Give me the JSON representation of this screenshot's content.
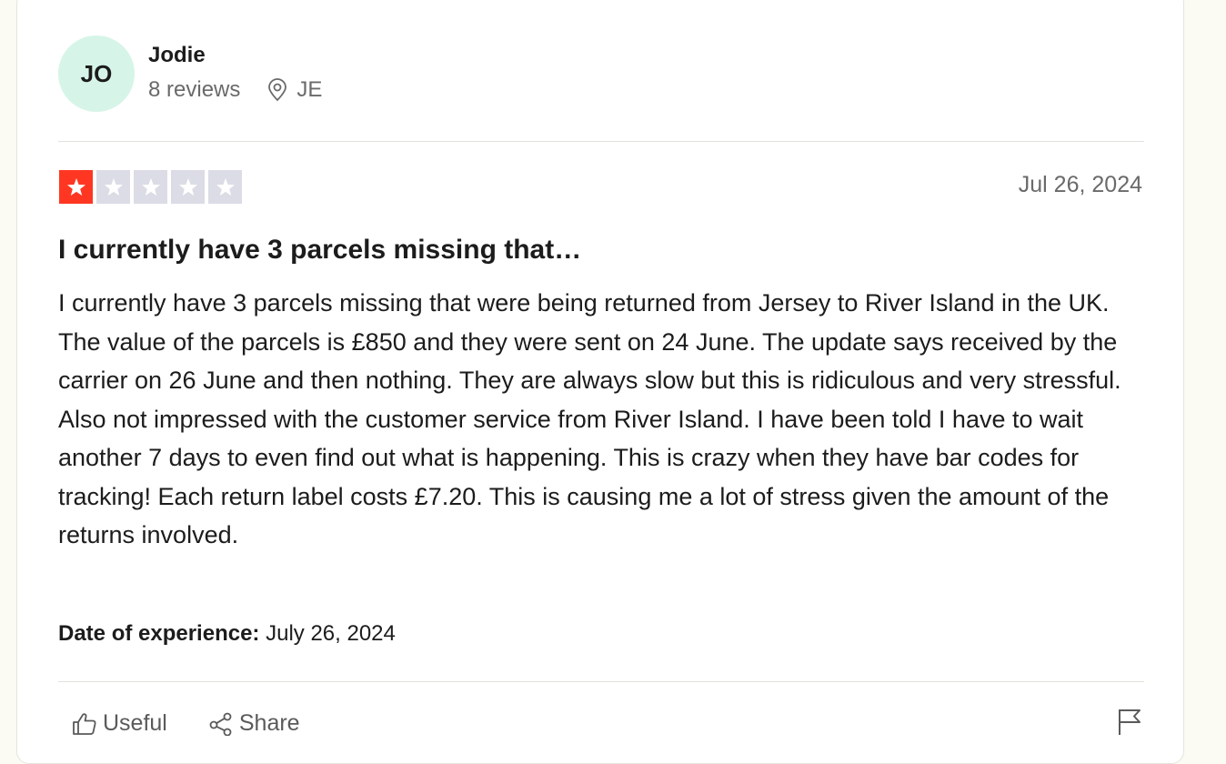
{
  "reviewer": {
    "initials": "JO",
    "name": "Jodie",
    "reviews_count": "8 reviews",
    "location": "JE",
    "avatar_color": "#d6f5e8"
  },
  "review": {
    "rating": 1,
    "max_rating": 5,
    "star_color_active": "#ff3722",
    "star_color_inactive": "#dcdce6",
    "date": "Jul 26, 2024",
    "title": "I currently have 3 parcels missing that…",
    "body": "I currently have 3 parcels missing that were being returned from Jersey to River Island in the UK. The value of the parcels is £850 and they were sent on 24 June. The update says received by the carrier on 26 June and then nothing. They are always slow but this is ridiculous and very stressful. Also not impressed with the customer service from River Island. I have been told I have to wait another 7 days to even find out what is happening. This is crazy when they have bar codes for tracking! Each return label costs £7.20. This is causing me a lot of stress given the amount of the returns involved.",
    "experience_label": "Date of experience:",
    "experience_date": "July 26, 2024"
  },
  "actions": {
    "useful_label": "Useful",
    "share_label": "Share",
    "useful_icon": "thumbs-up-icon",
    "share_icon": "share-icon",
    "flag_icon": "flag-icon"
  }
}
